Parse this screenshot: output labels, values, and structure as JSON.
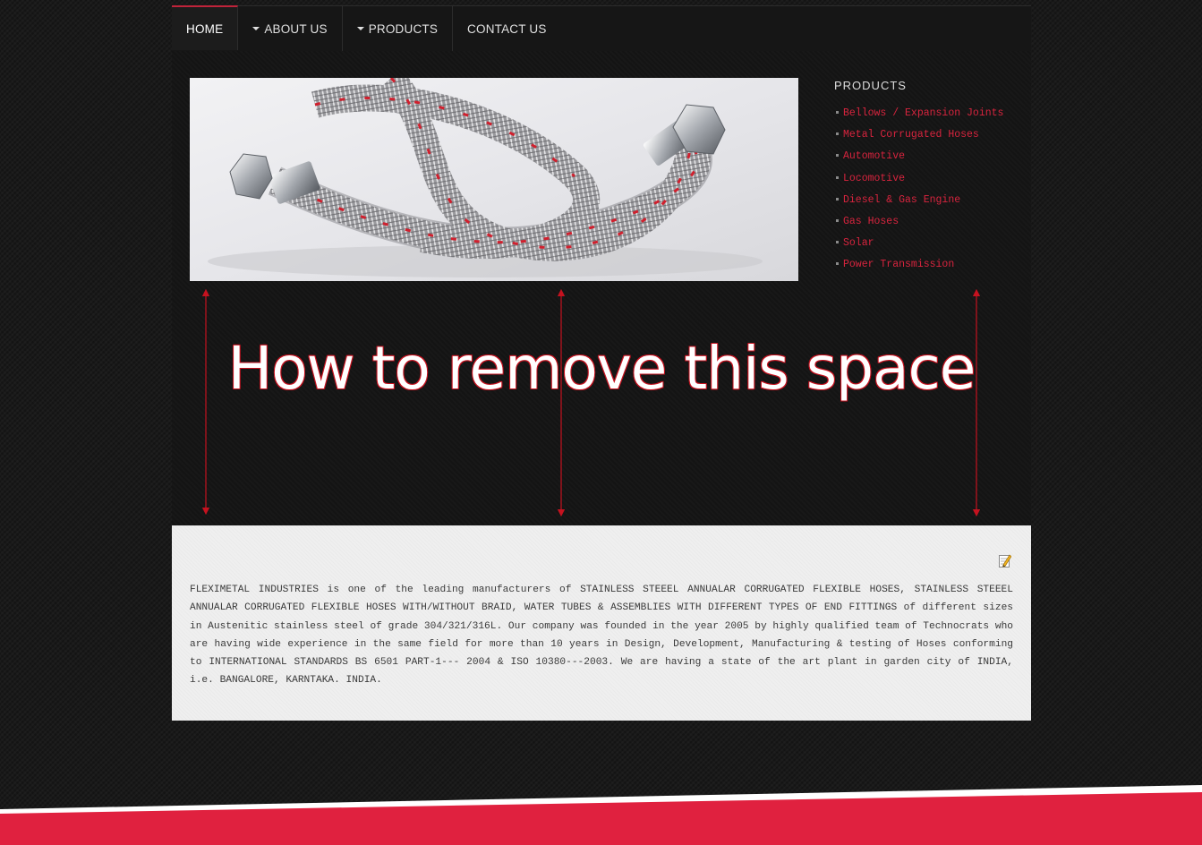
{
  "nav": {
    "items": [
      {
        "label": "HOME",
        "has_caret": false,
        "active": true
      },
      {
        "label": "ABOUT US",
        "has_caret": true,
        "active": false
      },
      {
        "label": "PRODUCTS",
        "has_caret": true,
        "active": false
      },
      {
        "label": "CONTACT US",
        "has_caret": false,
        "active": false
      }
    ]
  },
  "sidebar": {
    "title": "PRODUCTS",
    "items": [
      {
        "label": "Bellows / Expansion Joints"
      },
      {
        "label": "Metal Corrugated Hoses"
      },
      {
        "label": "Automotive"
      },
      {
        "label": "Locomotive"
      },
      {
        "label": "Diesel & Gas Engine"
      },
      {
        "label": "Gas Hoses"
      },
      {
        "label": "Solar"
      },
      {
        "label": "Power Transmission"
      }
    ]
  },
  "annotation": {
    "text": "How to remove this space",
    "color": "#c5121f"
  },
  "content": {
    "paragraph": "FLEXIMETAL INDUSTRIES is one of the leading manufacturers of STAINLESS STEEEL ANNUALAR CORRUGATED FLEXIBLE HOSES, STAINLESS STEEEL ANNUALAR CORRUGATED FLEXIBLE HOSES WITH/WITHOUT BRAID, WATER TUBES & ASSEMBLIES WITH DIFFERENT TYPES OF END FITTINGS of different sizes in Austenitic stainless steel of grade 304/321/316L. Our company was founded in the year 2005 by highly qualified team of Technocrats who are having wide experience in the same field for more than 10 years in Design, Development, Manufacturing & testing of Hoses conforming to INTERNATIONAL STANDARDS BS 6501 PART-1--- 2004 & ISO 10380---2003. We are having a state of the art plant in garden city of INDIA, i.e. BANGALORE, KARNTAKA. INDIA."
  },
  "icons": {
    "edit": "edit-pencil-icon",
    "banner": "braided-hose-image"
  },
  "colors": {
    "accent": "#d8243e",
    "footer": "#e0213f",
    "background": "#1a1a1a",
    "content_bg": "#efefef"
  }
}
